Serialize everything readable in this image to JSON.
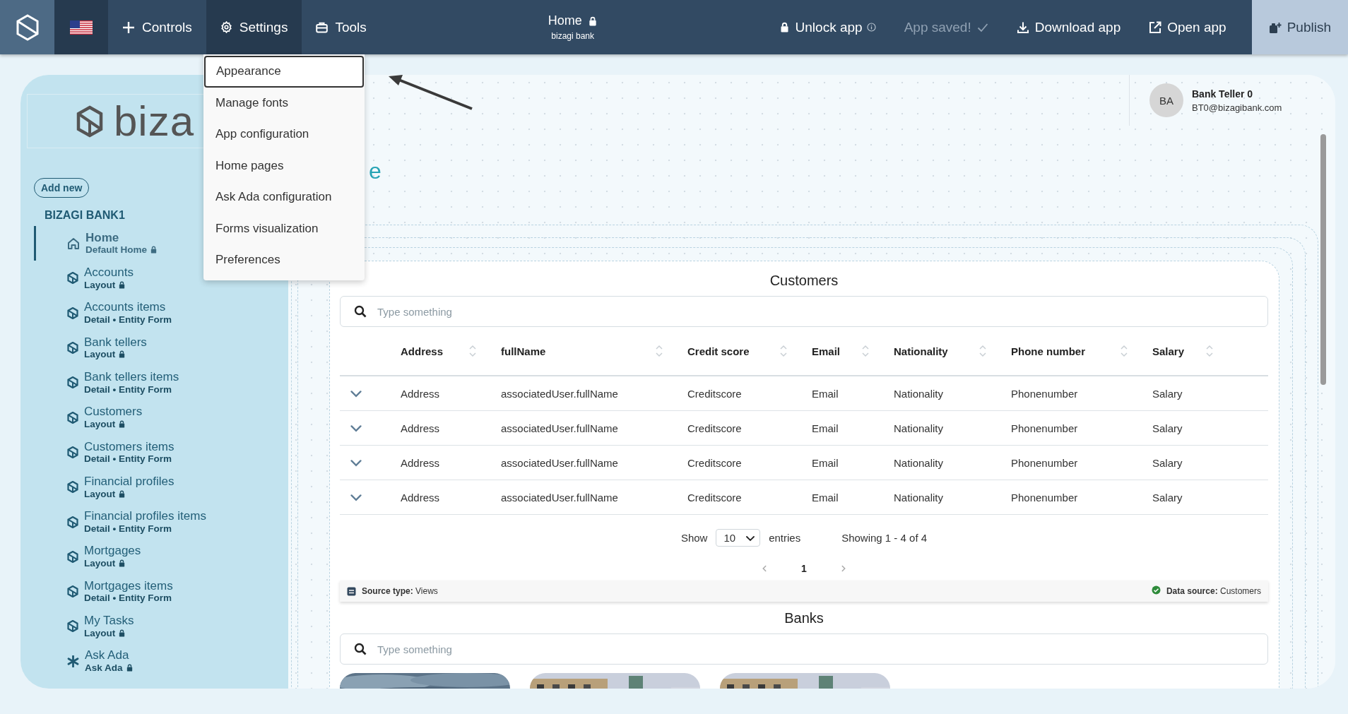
{
  "top_bar": {
    "nav": [
      {
        "label": "Controls",
        "selected": false
      },
      {
        "label": "Settings",
        "selected": true
      },
      {
        "label": "Tools",
        "selected": false
      }
    ],
    "page": {
      "title": "Home",
      "subtitle": "bizagi bank"
    },
    "actions": [
      {
        "label": "Unlock app",
        "kind": "unlock",
        "disabled": false
      },
      {
        "label": "App saved!",
        "kind": "status",
        "disabled": true
      },
      {
        "label": "Download app",
        "kind": "download",
        "disabled": false
      },
      {
        "label": "Open app",
        "kind": "open",
        "disabled": false
      },
      {
        "label": "Publish",
        "kind": "publish",
        "disabled": false
      }
    ]
  },
  "settings_menu": {
    "items": [
      {
        "label": "Appearance",
        "selected": true
      },
      {
        "label": "Manage fonts",
        "selected": false
      },
      {
        "label": "App configuration",
        "selected": false
      },
      {
        "label": "Home pages",
        "selected": false
      },
      {
        "label": "Ask Ada configuration",
        "selected": false
      },
      {
        "label": "Forms visualization",
        "selected": false
      },
      {
        "label": "Preferences",
        "selected": false
      }
    ]
  },
  "sidebar": {
    "logo_text": "biza",
    "add_button": "Add new",
    "app_name": "BIZAGI BANK1",
    "items": [
      {
        "title": "Home",
        "subtitle": "Default Home",
        "kind": "home",
        "locked": true,
        "selected": true
      },
      {
        "title": "Accounts",
        "subtitle": "Layout",
        "kind": "page",
        "locked": true,
        "selected": false
      },
      {
        "title": "Accounts items",
        "subtitle": "Detail • Entity Form",
        "kind": "page",
        "locked": false,
        "selected": false
      },
      {
        "title": "Bank tellers",
        "subtitle": "Layout",
        "kind": "page",
        "locked": true,
        "selected": false
      },
      {
        "title": "Bank tellers items",
        "subtitle": "Detail • Entity Form",
        "kind": "page",
        "locked": false,
        "selected": false
      },
      {
        "title": "Customers",
        "subtitle": "Layout",
        "kind": "page",
        "locked": true,
        "selected": false
      },
      {
        "title": "Customers items",
        "subtitle": "Detail • Entity Form",
        "kind": "page",
        "locked": false,
        "selected": false
      },
      {
        "title": "Financial profiles",
        "subtitle": "Layout",
        "kind": "page",
        "locked": true,
        "selected": false
      },
      {
        "title": "Financial profiles items",
        "subtitle": "Detail • Entity Form",
        "kind": "page",
        "locked": false,
        "selected": false
      },
      {
        "title": "Mortgages",
        "subtitle": "Layout",
        "kind": "page",
        "locked": true,
        "selected": false
      },
      {
        "title": "Mortgages items",
        "subtitle": "Detail • Entity Form",
        "kind": "page",
        "locked": false,
        "selected": false
      },
      {
        "title": "My Tasks",
        "subtitle": "Layout",
        "kind": "page",
        "locked": true,
        "selected": false
      },
      {
        "title": "Ask Ada",
        "subtitle": "Ask Ada",
        "kind": "assistant",
        "locked": true,
        "selected": false
      }
    ]
  },
  "canvas": {
    "heading": "e",
    "user": {
      "initials": "BA",
      "name": "Bank Teller 0",
      "email": "BT0@bizagibank.com"
    },
    "customers": {
      "title": "Customers",
      "search": {
        "placeholder": "Type something"
      },
      "columns": [
        "Address",
        "fullName",
        "Credit score",
        "Email",
        "Nationality",
        "Phone number",
        "Salary"
      ],
      "rows": [
        [
          "Address",
          "associatedUser.fullName",
          "Creditscore",
          "Email",
          "Nationality",
          "Phonenumber",
          "Salary"
        ],
        [
          "Address",
          "associatedUser.fullName",
          "Creditscore",
          "Email",
          "Nationality",
          "Phonenumber",
          "Salary"
        ],
        [
          "Address",
          "associatedUser.fullName",
          "Creditscore",
          "Email",
          "Nationality",
          "Phonenumber",
          "Salary"
        ],
        [
          "Address",
          "associatedUser.fullName",
          "Creditscore",
          "Email",
          "Nationality",
          "Phonenumber",
          "Salary"
        ]
      ],
      "show_label": "Show",
      "page_size": "10",
      "entries_label": "entries",
      "summary": "Showing 1 - 4 of 4",
      "pages": [
        {
          "label": "1",
          "selected": true
        }
      ],
      "source_type": {
        "label": "Source type:",
        "value": "Views"
      },
      "data_source": {
        "label": "Data source:",
        "value": "Customers"
      }
    },
    "banks": {
      "title": "Banks",
      "search": {
        "placeholder": "Type something"
      }
    }
  }
}
